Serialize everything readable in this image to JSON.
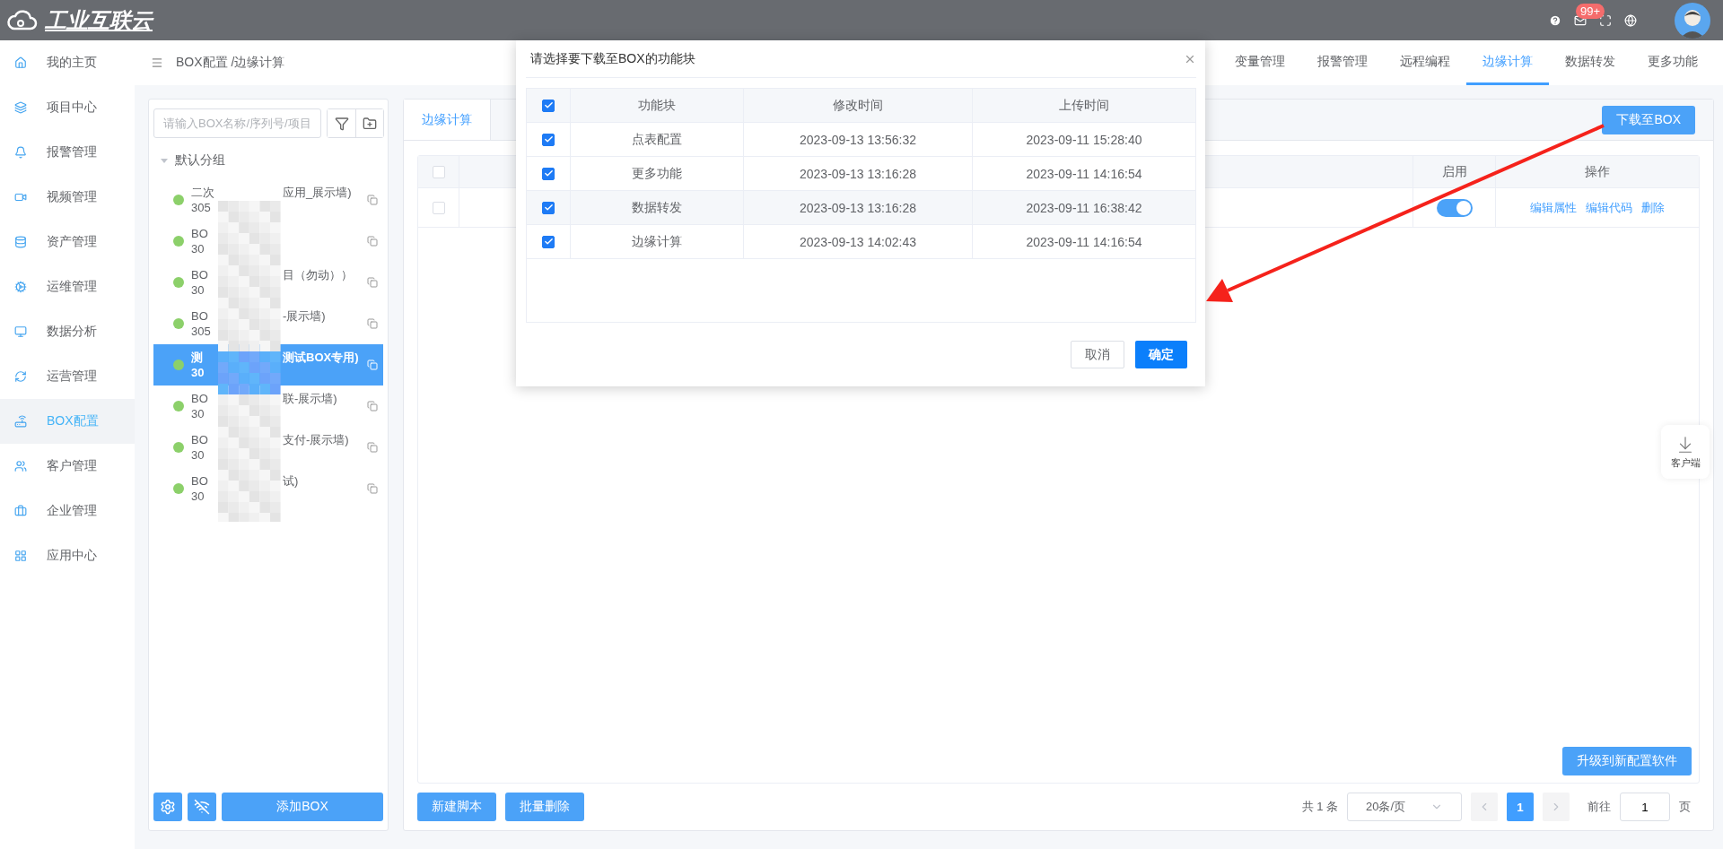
{
  "header": {
    "logo": "工业互联云",
    "badge": "99+"
  },
  "sidebar": {
    "items": [
      {
        "label": "我的主页",
        "selected": false
      },
      {
        "label": "项目中心",
        "selected": false
      },
      {
        "label": "报警管理",
        "selected": false
      },
      {
        "label": "视频管理",
        "selected": false
      },
      {
        "label": "资产管理",
        "selected": false
      },
      {
        "label": "运维管理",
        "selected": false
      },
      {
        "label": "数据分析",
        "selected": false
      },
      {
        "label": "运营管理",
        "selected": false
      },
      {
        "label": "BOX配置",
        "selected": true
      },
      {
        "label": "客户管理",
        "selected": false
      },
      {
        "label": "企业管理",
        "selected": false
      },
      {
        "label": "应用中心",
        "selected": false
      }
    ]
  },
  "breadcrumb": "BOX配置 /边缘计算",
  "tabs": [
    {
      "label": "变量管理",
      "selected": false
    },
    {
      "label": "报警管理",
      "selected": false
    },
    {
      "label": "远程编程",
      "selected": false
    },
    {
      "label": "边缘计算",
      "selected": true
    },
    {
      "label": "数据转发",
      "selected": false
    },
    {
      "label": "更多功能",
      "selected": false
    }
  ],
  "device_panel": {
    "search_placeholder": "请输入BOX名称/序列号/项目",
    "group": "默认分组",
    "add_button": "添加BOX",
    "items": [
      {
        "name_start": "二次",
        "name_end": "应用_展示墙)",
        "serial": "305",
        "online": true,
        "selected": false
      },
      {
        "name_start": "BO",
        "serial": "30",
        "online": true,
        "selected": false
      },
      {
        "name_start": "BO",
        "name_end": "目（勿动））",
        "serial": "30",
        "online": true,
        "selected": false
      },
      {
        "name_start": "BO",
        "name_end": "-展示墙)",
        "serial": "305",
        "online": true,
        "selected": false
      },
      {
        "name_start": "测",
        "name_end": "测试BOX专用)",
        "serial": "30",
        "online": true,
        "selected": true
      },
      {
        "name_start": "BO",
        "name_end": "联-展示墙)",
        "serial": "30",
        "online": true,
        "selected": false
      },
      {
        "name_start": "BO",
        "name_end": "支付-展示墙)",
        "serial": "30",
        "online": true,
        "selected": false
      },
      {
        "name_start": "BO",
        "name_end": "试)",
        "serial": "30",
        "online": true,
        "selected": false
      }
    ]
  },
  "editor": {
    "tab": {
      "label": "边缘计算",
      "selected": true
    },
    "download_button": "下载至BOX",
    "all_checked": false,
    "columns": [
      "启用",
      "操作"
    ],
    "rows": [
      {
        "checked": false,
        "enabled": true,
        "actions": [
          "编辑属性",
          "编辑代码",
          "删除"
        ]
      }
    ],
    "upgrade_button": "升级到新配置软件",
    "buttons": [
      "新建脚本",
      "批量删除"
    ],
    "pagination": {
      "total": "共 1 条",
      "page_size": "20条/页",
      "pages": [
        {
          "label": "1",
          "selected": true
        }
      ],
      "goto_label": "前往",
      "goto_value": "1",
      "page_unit": "页"
    }
  },
  "float_button": "客户端",
  "dialog": {
    "title": "请选择要下载至BOX的功能块",
    "all_checked": true,
    "columns": [
      "功能块",
      "修改时间",
      "上传时间"
    ],
    "rows": [
      {
        "checked": true,
        "cells": [
          "点表配置",
          "2023-09-13 13:56:32",
          "2023-09-11 15:28:40"
        ]
      },
      {
        "checked": true,
        "cells": [
          "更多功能",
          "2023-09-13 13:16:28",
          "2023-09-11 14:16:54"
        ]
      },
      {
        "checked": true,
        "cells": [
          "数据转发",
          "2023-09-13 13:16:28",
          "2023-09-11 16:38:42"
        ]
      },
      {
        "checked": true,
        "cells": [
          "边缘计算",
          "2023-09-13 14:02:43",
          "2023-09-11 14:16:54"
        ]
      }
    ],
    "cancel": "取消",
    "confirm": "确定"
  }
}
